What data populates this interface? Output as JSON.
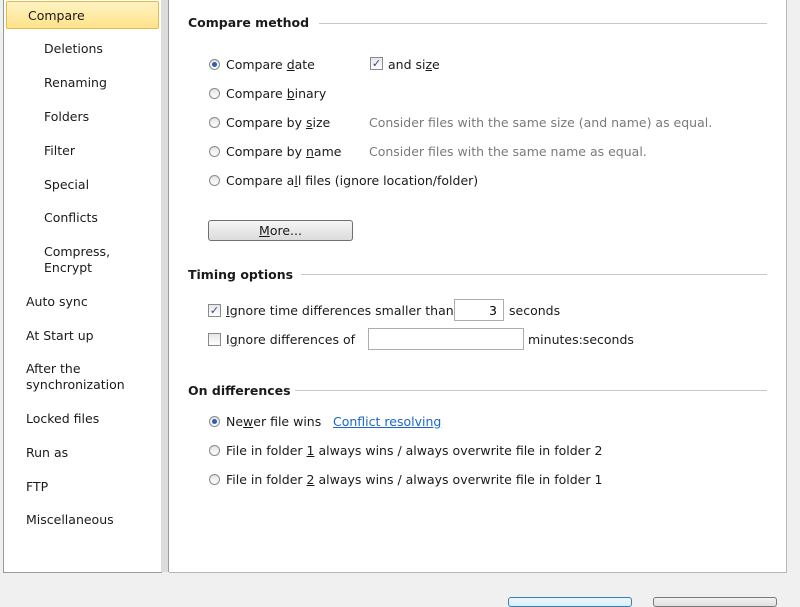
{
  "sidebar": {
    "items": [
      {
        "label": "Compare",
        "selected": true
      },
      {
        "label": "Deletions"
      },
      {
        "label": "Renaming"
      },
      {
        "label": "Folders"
      },
      {
        "label": "Filter"
      },
      {
        "label": "Special"
      },
      {
        "label": "Conflicts"
      },
      {
        "label": "Compress,"
      },
      {
        "label": "Encrypt"
      },
      {
        "label": "Auto sync"
      },
      {
        "label": "At Start up"
      },
      {
        "label": "After the"
      },
      {
        "label": "synchronization"
      },
      {
        "label": "Locked files"
      },
      {
        "label": "Run as"
      },
      {
        "label": "FTP"
      },
      {
        "label": "Miscellaneous"
      }
    ]
  },
  "compare_method": {
    "title": "Compare method",
    "options": [
      {
        "pre": "Compare ",
        "ul": "d",
        "post": "ate",
        "selected": true
      },
      {
        "pre": "Compare ",
        "ul": "b",
        "post": "inary",
        "selected": false
      },
      {
        "pre": "Compare by ",
        "ul": "s",
        "post": "ize",
        "selected": false
      },
      {
        "pre": "Compare by ",
        "ul": "n",
        "post": "ame",
        "selected": false
      },
      {
        "pre": "Compare a",
        "ul": "l",
        "post": "l files (ignore location/folder)",
        "selected": false
      }
    ],
    "and_size": {
      "pre": "and si",
      "ul": "z",
      "post": "e",
      "checked": true
    },
    "hint_size": "Consider files with the same size (and name) as equal.",
    "hint_name": "Consider files with the same name as equal.",
    "more_button": {
      "ul": "M",
      "post": "ore..."
    }
  },
  "timing": {
    "title": "Timing options",
    "ignore_small": {
      "ul": "I",
      "post": "gnore time differences smaller than:",
      "checked": true,
      "value": "3",
      "unit": "seconds"
    },
    "ignore_diff": {
      "pre": "I",
      "ul": "g",
      "post": "nore differences of",
      "checked": false,
      "value": "",
      "unit": "minutes:seconds"
    }
  },
  "differences": {
    "title": "On differences",
    "options": [
      {
        "pre": "Ne",
        "ul": "w",
        "post": "er file wins",
        "selected": true
      },
      {
        "pre": "File in folder ",
        "ul": "1",
        "post": " always wins / always overwrite file in folder 2",
        "selected": false
      },
      {
        "pre": "File in folder ",
        "ul": "2",
        "post": " always wins / always overwrite file in folder 1",
        "selected": false
      }
    ],
    "conflict_link": "Conflict resolving"
  },
  "icons": {
    "check": "✓"
  }
}
